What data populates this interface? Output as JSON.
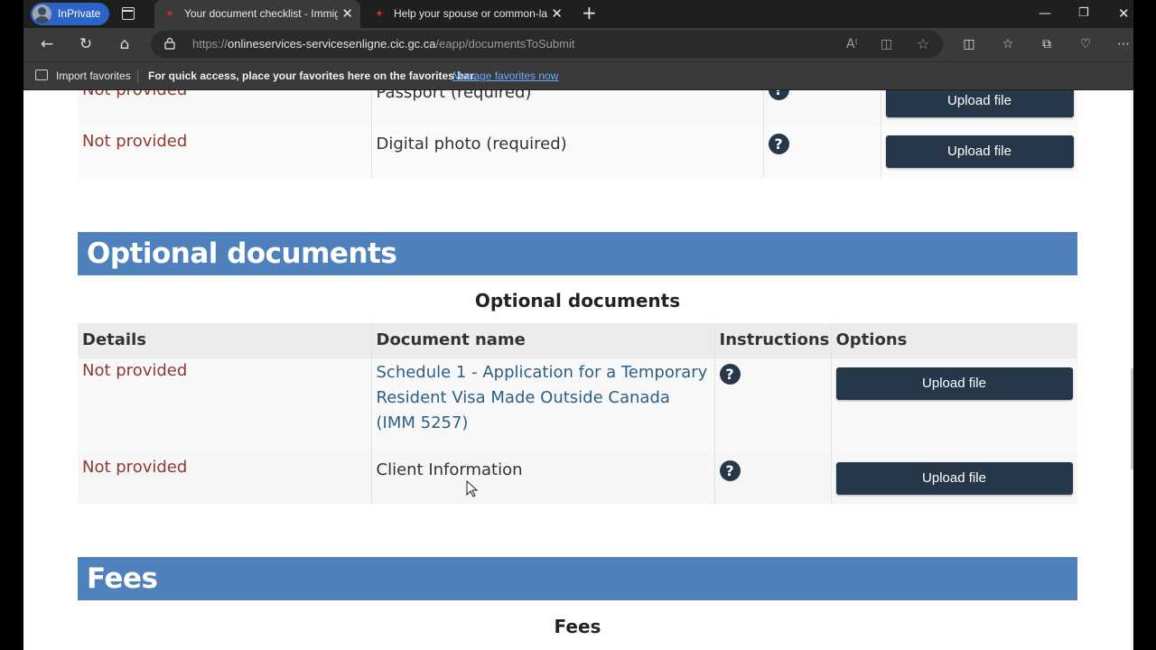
{
  "browser": {
    "inprivate_label": "InPrivate",
    "tabs": [
      {
        "title": "Your document checklist - Immigr",
        "active": true
      },
      {
        "title": "Help your spouse or common-la",
        "active": false
      }
    ],
    "new_tab_glyph": "+",
    "address": {
      "url_scheme": "https://",
      "url_host": "onlineservices-servicesenligne.cic.gc.ca",
      "url_path": "/eapp/documentsToSubmit"
    },
    "favorites_bar": {
      "import_label": "Import favorites",
      "hint": "For quick access, place your favorites here on the favorites bar.",
      "manage_link": "Manage favorites now"
    }
  },
  "page": {
    "required_rows": [
      {
        "details": "Not provided",
        "document": "Passport  (required)",
        "button": "Upload file"
      },
      {
        "details": "Not provided",
        "document": "Digital photo  (required)",
        "button": "Upload file"
      }
    ],
    "optional": {
      "heading": "Optional documents",
      "caption": "Optional documents",
      "columns": [
        "Details",
        "Document name",
        "Instructions",
        "Options"
      ],
      "rows": [
        {
          "details": "Not provided",
          "document": "Schedule 1 - Application for a Temporary Resident Visa Made Outside Canada (IMM 5257)",
          "button": "Upload file"
        },
        {
          "details": "Not provided",
          "document": "Client Information",
          "button": "Upload file"
        }
      ]
    },
    "fees": {
      "heading": "Fees",
      "caption": "Fees"
    },
    "help_glyph": "?"
  },
  "colors": {
    "section_header": "#4f81bd",
    "button": "#26374a",
    "not_provided_text": "#8c3b33",
    "link_text": "#2d5f86"
  }
}
